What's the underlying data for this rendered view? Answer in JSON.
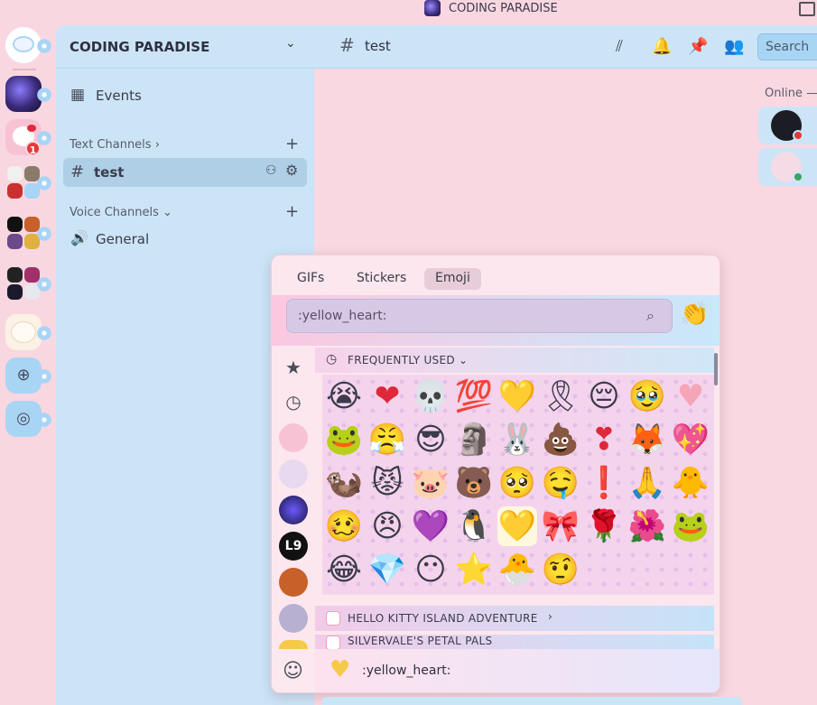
{
  "window": {
    "title": "CODING PARADISE"
  },
  "server": {
    "name": "CODING PARADISE",
    "badge_count": "1"
  },
  "channels": {
    "events_label": "Events",
    "text_category": "Text Channels",
    "text_channel": "test",
    "voice_category": "Voice Channels",
    "voice_channel": "General"
  },
  "chat": {
    "channel_name": "test",
    "search_placeholder": "Search"
  },
  "members": {
    "header": "Online —"
  },
  "emoji_picker": {
    "tabs": [
      "GIFs",
      "Stickers",
      "Emoji"
    ],
    "active_tab": "Emoji",
    "search_value": ":yellow_heart:",
    "section_frequent": "FREQUENTLY USED",
    "group_hello_kitty": "HELLO KITTY ISLAND ADVENTURE",
    "group_silvervale": "SILVERVALE'S PETAL PALS",
    "preview_name": ":yellow_heart:",
    "emojis": [
      {
        "glyph": "😭",
        "name": "sob"
      },
      {
        "glyph": "❤",
        "name": "heart",
        "color": "#e0283b"
      },
      {
        "glyph": "💀",
        "name": "skull"
      },
      {
        "glyph": "💯",
        "name": "100",
        "color": "#e0283b"
      },
      {
        "glyph": "💛",
        "name": "custom-heart"
      },
      {
        "glyph": "🎗",
        "name": "custom-ribbon"
      },
      {
        "glyph": "😔",
        "name": "pensive"
      },
      {
        "glyph": "🥹",
        "name": "face-holding-back-tears"
      },
      {
        "glyph": "♥",
        "name": "pink-heart",
        "color": "#f4a6b8"
      },
      {
        "glyph": "🐸",
        "name": "custom-frog"
      },
      {
        "glyph": "😤",
        "name": "triumph"
      },
      {
        "glyph": "😎",
        "name": "sunglasses"
      },
      {
        "glyph": "🗿",
        "name": "moyai"
      },
      {
        "glyph": "🐰",
        "name": "custom-cinnamoroll"
      },
      {
        "glyph": "💩",
        "name": "poop"
      },
      {
        "glyph": "❣",
        "name": "hearts",
        "color": "#e0283b"
      },
      {
        "glyph": "🦊",
        "name": "custom-fox"
      },
      {
        "glyph": "💖",
        "name": "sparkling-heart"
      },
      {
        "glyph": "🦦",
        "name": "custom-otter"
      },
      {
        "glyph": "😾",
        "name": "pouting-cat"
      },
      {
        "glyph": "🐷",
        "name": "custom-pink-bun"
      },
      {
        "glyph": "🐻",
        "name": "custom-bear"
      },
      {
        "glyph": "🥺",
        "name": "pleading"
      },
      {
        "glyph": "🤤",
        "name": "drooling"
      },
      {
        "glyph": "❗",
        "name": "exclamation",
        "color": "#e0283b"
      },
      {
        "glyph": "🙏",
        "name": "pray"
      },
      {
        "glyph": "🐥",
        "name": "custom-kitty"
      },
      {
        "glyph": "🥴",
        "name": "woozy"
      },
      {
        "glyph": "😠",
        "name": "angry"
      },
      {
        "glyph": "💜",
        "name": "purple-heart",
        "color": "#a98fe0"
      },
      {
        "glyph": "🐧",
        "name": "custom-badtz-maru"
      },
      {
        "glyph": "💛",
        "name": "yellow-heart",
        "color": "#f7c948"
      },
      {
        "glyph": "🎀",
        "name": "custom-bow"
      },
      {
        "glyph": "🌹",
        "name": "rose"
      },
      {
        "glyph": "🌺",
        "name": "hibiscus"
      },
      {
        "glyph": "🐸",
        "name": "custom-keroppi"
      },
      {
        "glyph": "😂",
        "name": "joy"
      },
      {
        "glyph": "💎",
        "name": "custom-gem"
      },
      {
        "glyph": "😶",
        "name": "no-mouth"
      },
      {
        "glyph": "⭐",
        "name": "star"
      },
      {
        "glyph": "🐣",
        "name": "custom-gudetama"
      },
      {
        "glyph": "🤨",
        "name": "raised-eyebrow"
      }
    ],
    "selected_index": 31
  },
  "colors": {
    "accent_pink": "#f8d7e1",
    "accent_blue": "#cbe5f7",
    "badge_red": "#e53935"
  }
}
